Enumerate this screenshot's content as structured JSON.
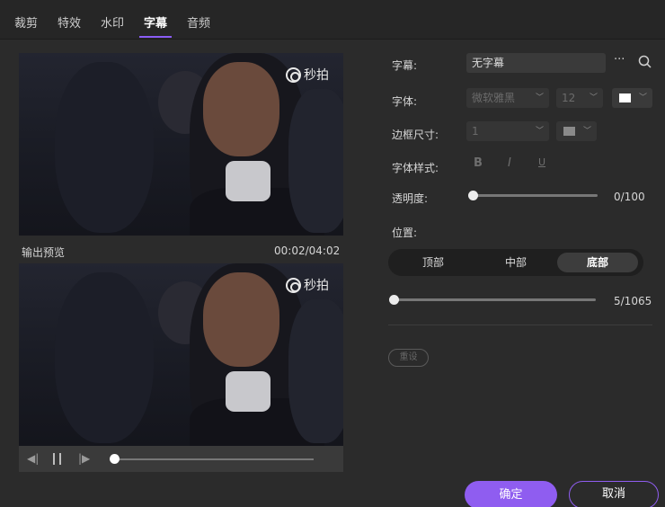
{
  "tabs": [
    {
      "label": "裁剪",
      "active": false
    },
    {
      "label": "特效",
      "active": false
    },
    {
      "label": "水印",
      "active": false
    },
    {
      "label": "字幕",
      "active": true
    },
    {
      "label": "音频",
      "active": false
    }
  ],
  "preview": {
    "watermark_text": "秒拍",
    "output_label": "输出预览",
    "time": "00:02/04:02",
    "progress": 0.0
  },
  "subtitle": {
    "label": "字幕:",
    "value": "无字幕",
    "more_icon": "ellipsis-icon",
    "search_icon": "search-icon"
  },
  "font": {
    "label": "字体:",
    "family": "微软雅黑",
    "size": "12",
    "color": "#ffffff"
  },
  "border": {
    "label": "边框尺寸:",
    "size": "1",
    "color": "#8a8a8a"
  },
  "font_style": {
    "label": "字体样式:",
    "bold": "B",
    "italic": "I",
    "underline": "U"
  },
  "opacity": {
    "label": "透明度:",
    "value_text": "0/100",
    "fraction": 0.0
  },
  "position": {
    "label": "位置:",
    "options": [
      "顶部",
      "中部",
      "底部"
    ],
    "selected": "底部"
  },
  "frame_slider": {
    "value_text": "5/1065",
    "fraction": 0.0047
  },
  "buttons": {
    "reset": "重设",
    "ok": "确定",
    "cancel": "取消"
  },
  "colors": {
    "accent": "#8f5df0",
    "background": "#2b2b2b"
  }
}
